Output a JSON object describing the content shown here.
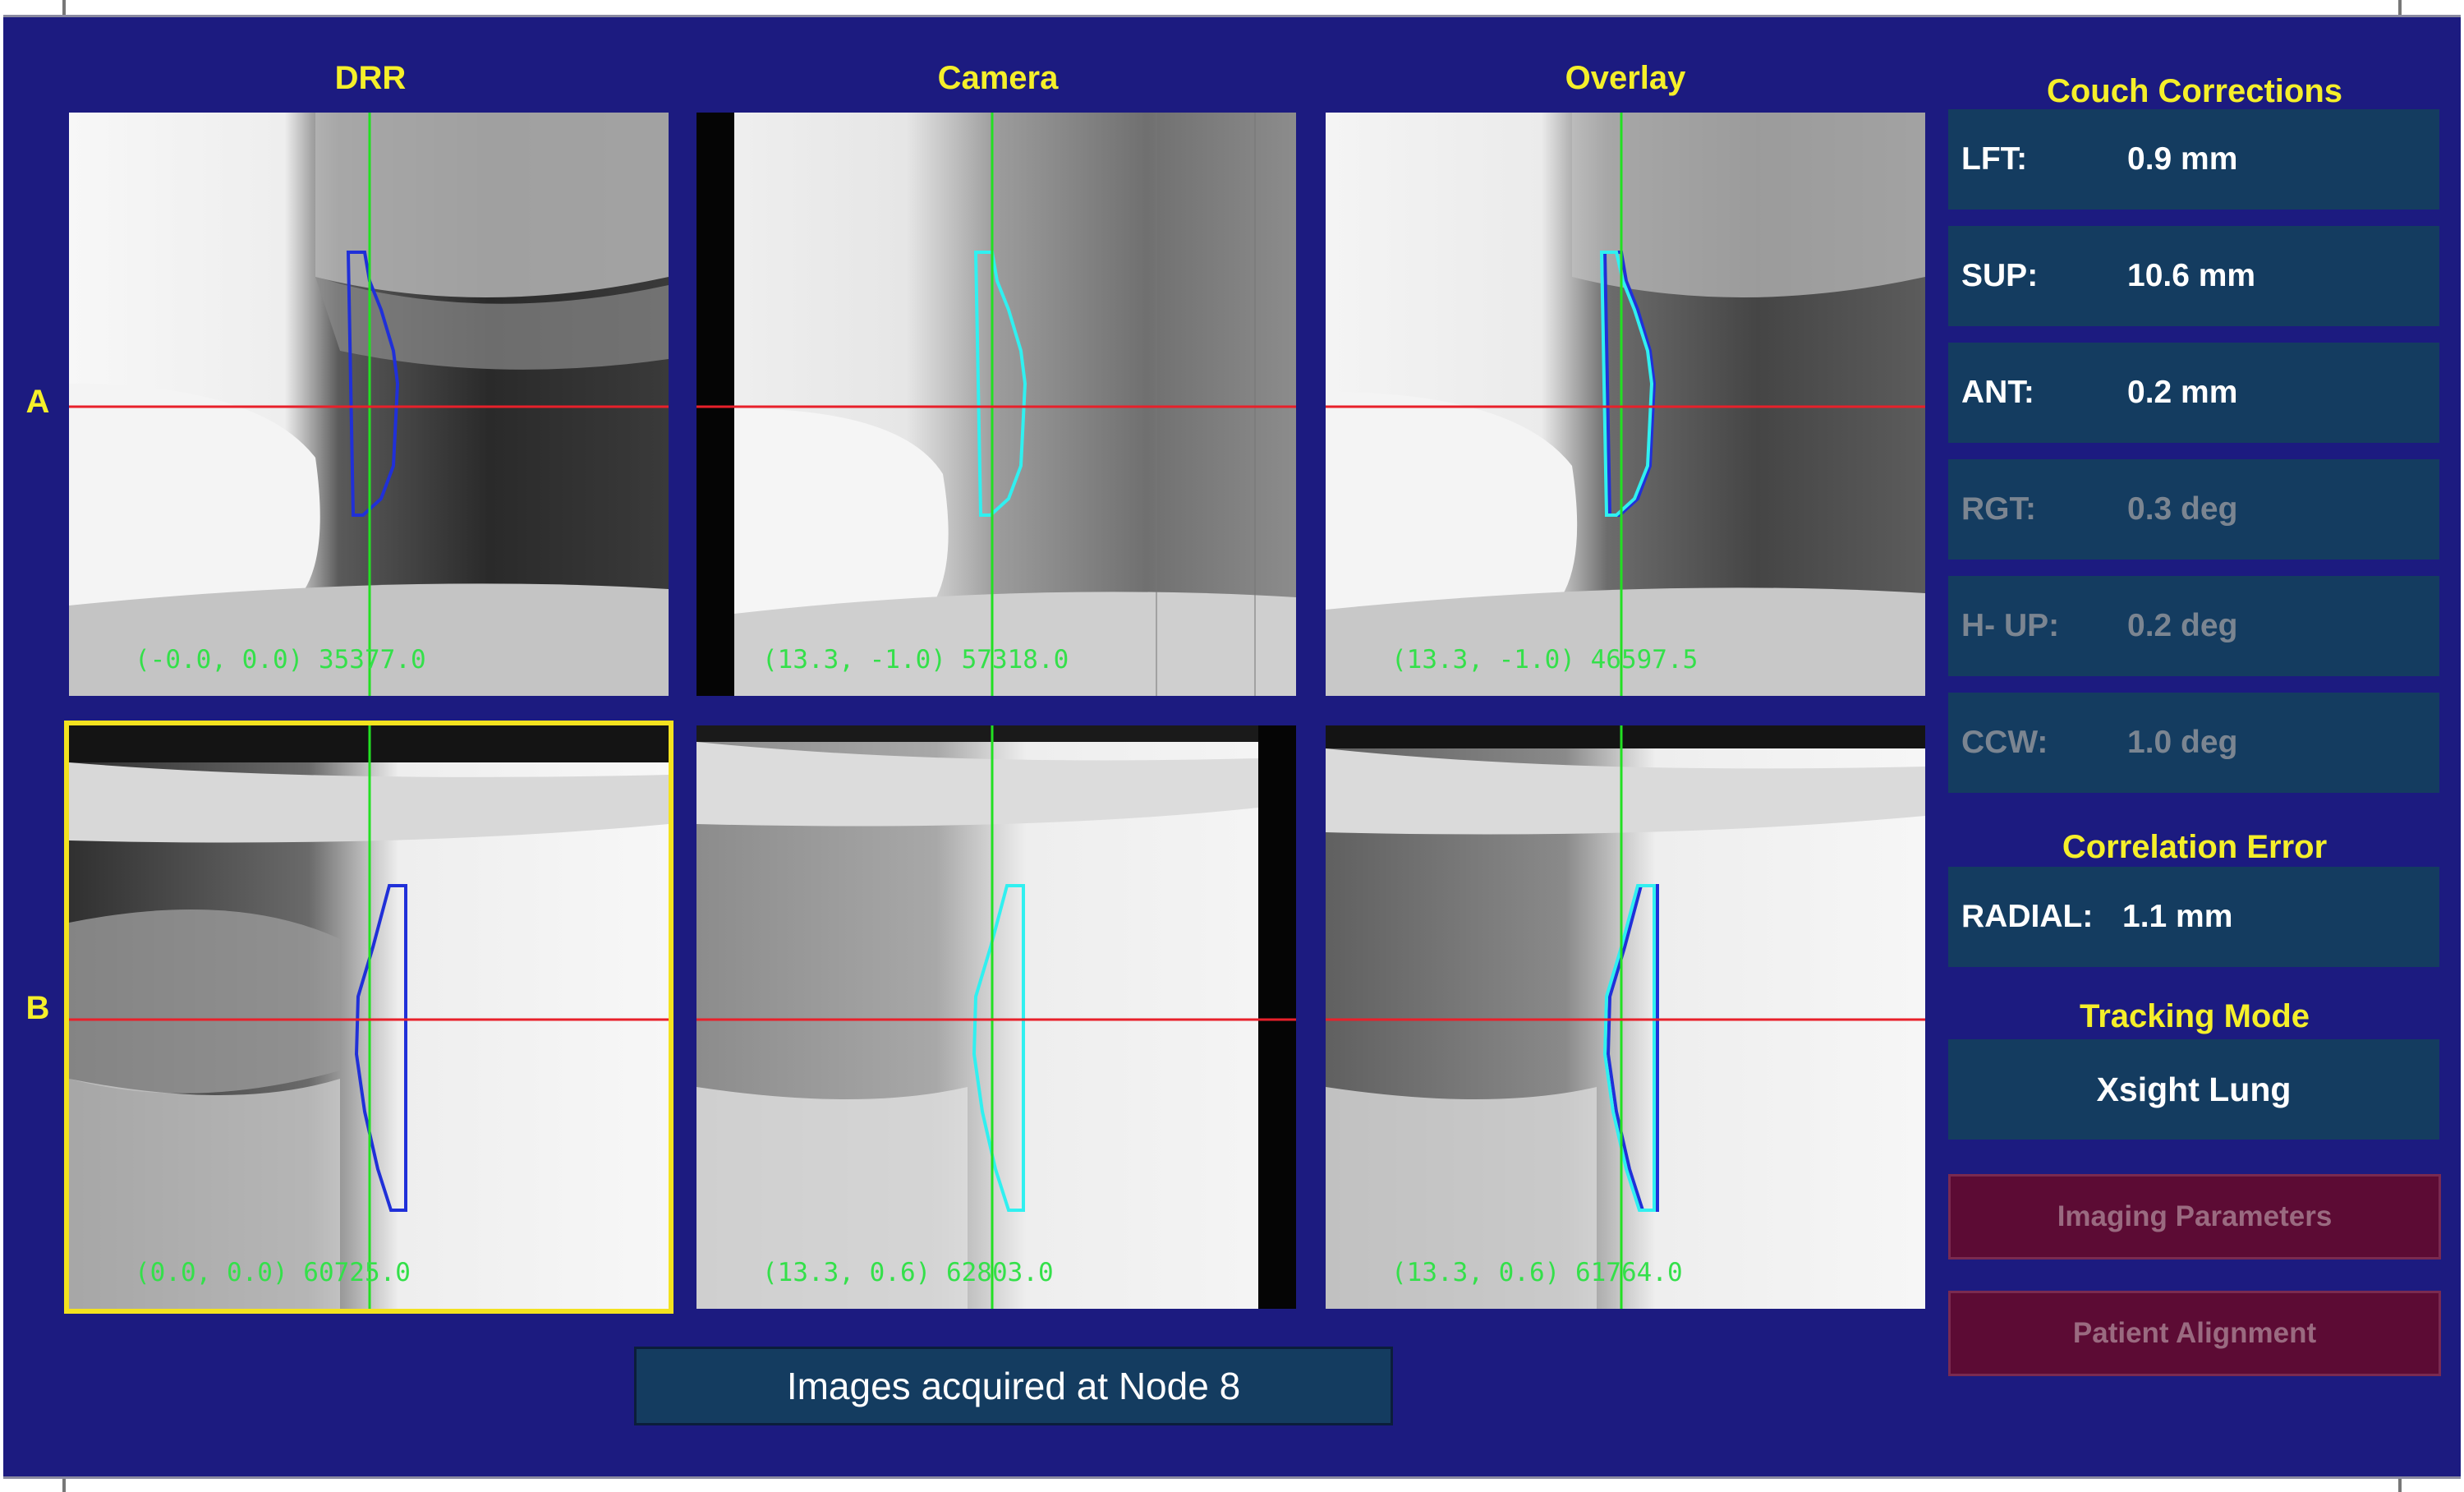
{
  "columns": {
    "drr": "DRR",
    "camera": "Camera",
    "overlay": "Overlay"
  },
  "rows": {
    "a": "A",
    "b": "B"
  },
  "panels": {
    "a_drr": {
      "readout": "(-0.0, 0.0) 35377.0"
    },
    "a_camera": {
      "readout": "(13.3, -1.0) 57318.0"
    },
    "a_overlay": {
      "readout": "(13.3, -1.0) 46597.5"
    },
    "b_drr": {
      "readout": "(0.0, 0.0) 60725.0",
      "selected": true
    },
    "b_camera": {
      "readout": "(13.3, 0.6) 62803.0"
    },
    "b_overlay": {
      "readout": "(13.3, 0.6) 61764.0"
    }
  },
  "couch_corrections": {
    "title": "Couch Corrections",
    "items": [
      {
        "label": "LFT:",
        "value": "0.9 mm",
        "enabled": true
      },
      {
        "label": "SUP:",
        "value": "10.6 mm",
        "enabled": true
      },
      {
        "label": "ANT:",
        "value": "0.2 mm",
        "enabled": true
      },
      {
        "label": "RGT:",
        "value": "0.3 deg",
        "enabled": false
      },
      {
        "label": "H- UP:",
        "value": "0.2 deg",
        "enabled": false
      },
      {
        "label": "CCW:",
        "value": "1.0 deg",
        "enabled": false
      }
    ]
  },
  "correlation_error": {
    "title": "Correlation Error",
    "label": "RADIAL:",
    "value": "1.1 mm"
  },
  "tracking_mode": {
    "title": "Tracking Mode",
    "value": "Xsight Lung"
  },
  "buttons": {
    "imaging_parameters": "Imaging Parameters",
    "patient_alignment": "Patient Alignment"
  },
  "status": "Images acquired at Node 8",
  "colors": {
    "background": "#1c1b80",
    "heading": "#f5ef2a",
    "value_box": "#143c60",
    "button": "#5c0b34",
    "crosshair_vertical": "#22e022",
    "crosshair_horizontal": "#e8202a",
    "contour_drr": "#2030d8",
    "contour_camera": "#30f0f0",
    "readout": "#34e04a",
    "selection": "#f3e21f"
  }
}
